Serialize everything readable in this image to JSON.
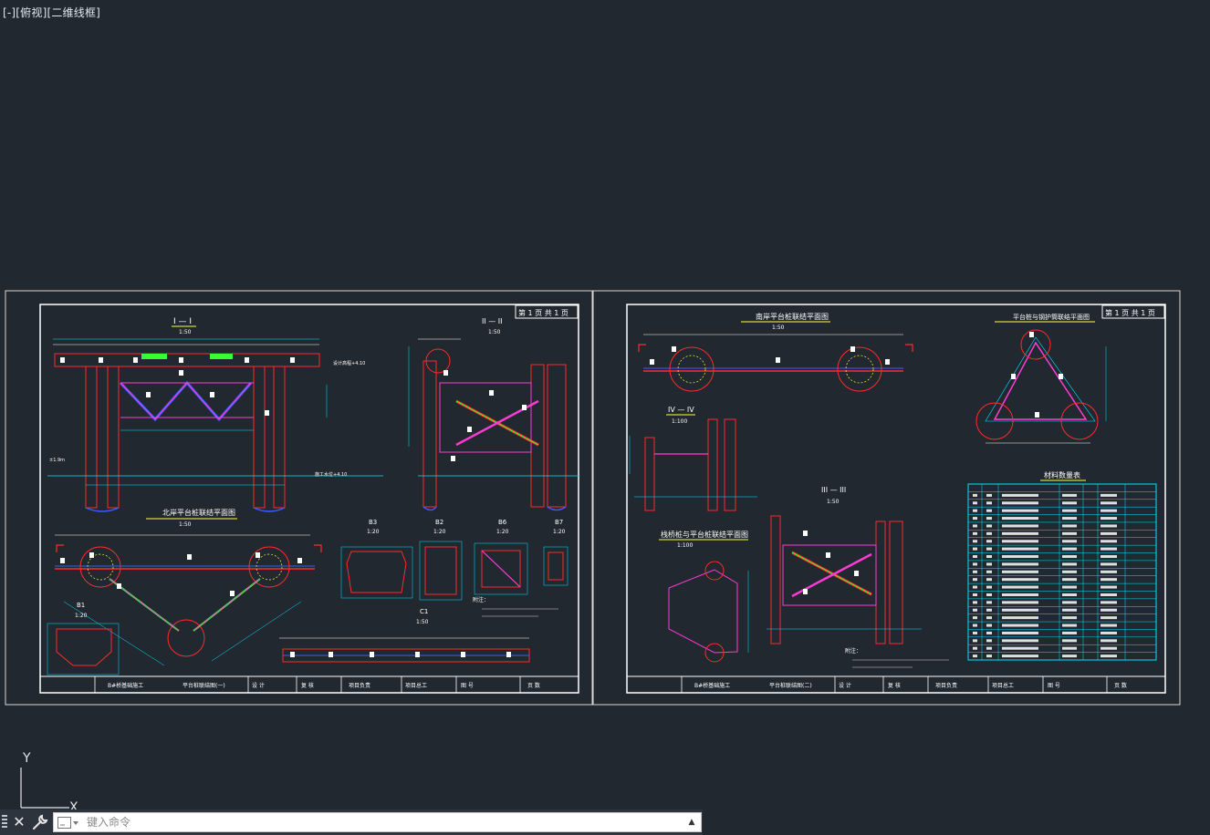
{
  "viewport": {
    "label_parts": [
      "[-]",
      "[俯视]",
      "[二维线框]"
    ]
  },
  "ucs": {
    "y_label": "Y",
    "x_label": "X"
  },
  "command_line": {
    "placeholder": "键入命令",
    "history_arrow": "▲",
    "close_glyph": "✕"
  },
  "colors": {
    "background": "#212830",
    "frame": "#ffffff",
    "cyan": "#00e5ff",
    "red": "#ff2a2a",
    "magenta": "#ff3bd4",
    "yellow": "#ffff3a",
    "green": "#33ff33",
    "blue": "#3b5bff"
  },
  "sheets": [
    {
      "page_tag": "第 1 页  共 1 页",
      "views": [
        {
          "title": "I — I",
          "scale": "1:50"
        },
        {
          "title": "II — II",
          "scale": "1:50"
        },
        {
          "title": "北岸平台桩联结平面图",
          "scale": "1:50"
        },
        {
          "title": "B3",
          "scale": "1:20"
        },
        {
          "title": "B2",
          "scale": "1:20"
        },
        {
          "title": "B6",
          "scale": "1:20"
        },
        {
          "title": "B7",
          "scale": "1:20"
        },
        {
          "title": "B1",
          "scale": "1:20"
        },
        {
          "title": "C1",
          "scale": "1:50"
        }
      ],
      "note_title": "附注：",
      "title_block": [
        "B#桥基础施工",
        "平台桩联结图(一)",
        "设 计",
        "复 核",
        "项目负责",
        "项目总工",
        "图 号",
        "",
        "页 数"
      ]
    },
    {
      "page_tag": "第 1 页  共 1 页",
      "views": [
        {
          "title": "南岸平台桩联结平面图",
          "scale": "1:50"
        },
        {
          "title": "平台桩与钢护筒联结平面图",
          "scale": ""
        },
        {
          "title": "IV — IV",
          "scale": "1:100"
        },
        {
          "title": "III — III",
          "scale": "1:50"
        },
        {
          "title": "栈桥桩与平台桩联结平面图",
          "scale": "1:100"
        },
        {
          "title": "材料数量表",
          "scale": ""
        }
      ],
      "note_title": "附注：",
      "title_block": [
        "B#桥基础施工",
        "平台桩联结图(二)",
        "设 计",
        "复 核",
        "项目负责",
        "项目总工",
        "图 号",
        "",
        "页 数"
      ]
    }
  ]
}
